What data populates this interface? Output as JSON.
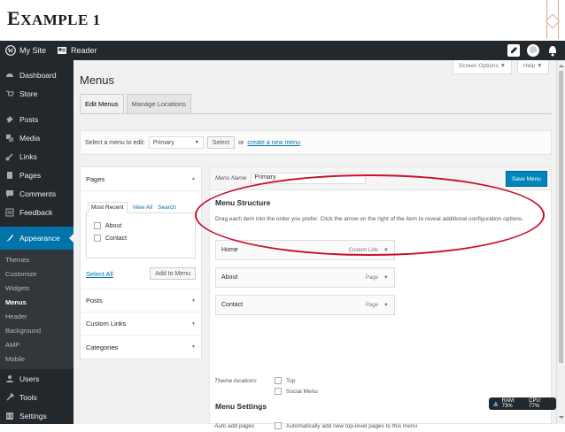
{
  "slide": {
    "title_first": "E",
    "title_rest": "XAMPLE 1"
  },
  "adminbar": {
    "my_site": "My Site",
    "reader": "Reader"
  },
  "sidebar": {
    "items_top": [
      {
        "label": "Dashboard",
        "icon": "dashboard-icon"
      },
      {
        "label": "Store",
        "icon": "store-icon"
      },
      {
        "label": "Posts",
        "icon": "pin-icon"
      },
      {
        "label": "Media",
        "icon": "media-icon"
      },
      {
        "label": "Links",
        "icon": "link-icon"
      },
      {
        "label": "Pages",
        "icon": "pages-icon"
      },
      {
        "label": "Comments",
        "icon": "comments-icon"
      },
      {
        "label": "Feedback",
        "icon": "feedback-icon"
      }
    ],
    "active": {
      "label": "Appearance",
      "icon": "appearance-icon"
    },
    "sub": [
      "Themes",
      "Customize",
      "Widgets",
      "Menus",
      "Header",
      "Background",
      "AMP",
      "Mobile"
    ],
    "current_sub": "Menus",
    "items_bottom": [
      {
        "label": "Users",
        "icon": "users-icon"
      },
      {
        "label": "Tools",
        "icon": "tools-icon"
      },
      {
        "label": "Settings",
        "icon": "settings-icon"
      }
    ]
  },
  "main": {
    "title": "Menus",
    "screen_options": "Screen Options ▼",
    "help": "Help ▼",
    "tabs": [
      "Edit Menus",
      "Manage Locations"
    ],
    "select_label": "Select a menu to edit:",
    "select_value": "Primary",
    "select_button": "Select",
    "or_text": "or",
    "create_link": "create a new menu",
    "left_panel": {
      "pages_title": "Pages",
      "tab_recent": "Most Recent",
      "tab_all": "View All",
      "tab_search": "Search",
      "pages": [
        "About",
        "Contact"
      ],
      "select_all": "Select All",
      "add_button": "Add to Menu",
      "sections": [
        "Posts",
        "Custom Links",
        "Categories"
      ]
    },
    "right_panel": {
      "menu_name_label": "Menu Name",
      "menu_name_value": "Primary",
      "save_button": "Save Menu",
      "structure_title": "Menu Structure",
      "structure_desc": "Drag each item into the order you prefer. Click the arrow on the right of the item to reveal additional configuration options.",
      "items": [
        {
          "label": "Home",
          "type": "Custom Link"
        },
        {
          "label": "About",
          "type": "Page"
        },
        {
          "label": "Contact",
          "type": "Page"
        }
      ],
      "settings_title": "Menu Settings",
      "auto_add_label": "Auto add pages",
      "auto_add_text": "Automatically add new top-level pages to this menu",
      "theme_locations_label": "Theme locations",
      "locations": [
        "Top",
        "Social Menu"
      ]
    }
  },
  "status": {
    "ram": "RAM: 73%",
    "cpu": "CPU: 77%"
  },
  "colors": {
    "accent": "#0073aa",
    "adminbar": "#23282d",
    "highlight": "#c8102e"
  }
}
